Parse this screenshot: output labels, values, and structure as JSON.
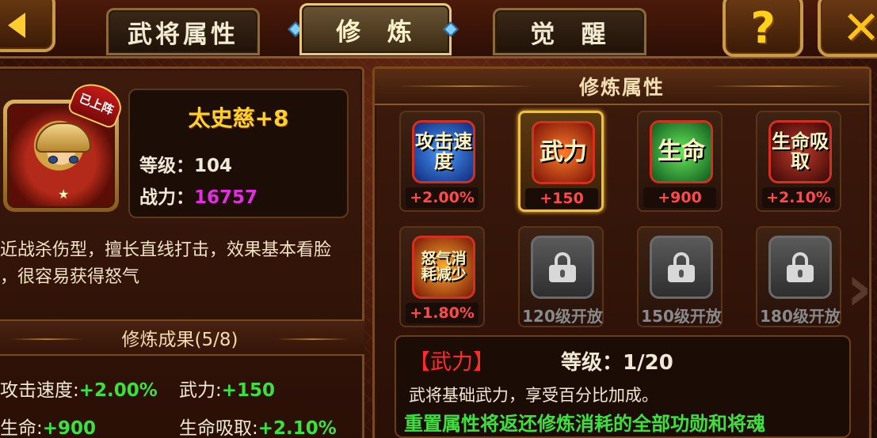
{
  "tabs": [
    {
      "label": "武将属性"
    },
    {
      "label": "修  炼"
    },
    {
      "label": "觉  醒"
    }
  ],
  "buttons": {
    "help": "?",
    "close": "✕",
    "back": "back-arrow-icon"
  },
  "hero": {
    "name": "太史慈+8",
    "badge": "已上阵",
    "level_label": "等级：",
    "level": "104",
    "power_label": "战力：",
    "power": "16757",
    "description_line1": "近战杀伤型，擅长直线打击，效果基本看脸",
    "description_line2": "，很容易获得怒气"
  },
  "training_result": {
    "title": "修炼成果(5/8)",
    "items": [
      {
        "label": "攻击速度:",
        "value": "+2.00%"
      },
      {
        "label": "武力:",
        "value": "+150"
      },
      {
        "label": "生命:",
        "value": "+900"
      },
      {
        "label": "生命吸取:",
        "value": "+2.10%"
      }
    ]
  },
  "training_attr": {
    "title": "修炼属性",
    "slots": [
      {
        "icon_text": "攻击速度",
        "value": "+2.00%",
        "icon": "attack-speed-icon"
      },
      {
        "icon_text": "武力",
        "value": "+150",
        "icon": "force-icon"
      },
      {
        "icon_text": "生命",
        "value": "+900",
        "icon": "life-icon"
      },
      {
        "icon_text": "生命吸取",
        "value": "+2.10%",
        "icon": "life-steal-icon"
      },
      {
        "icon_text": "怒气消耗减少",
        "value": "+1.80%",
        "icon": "rage-reduce-icon"
      },
      {
        "lock_text": "120级开放",
        "icon": "lock-icon"
      },
      {
        "lock_text": "150级开放",
        "icon": "lock-icon"
      },
      {
        "lock_text": "180级开放",
        "icon": "lock-icon"
      }
    ]
  },
  "detail": {
    "name": "【武力】",
    "level_label": "等级：",
    "level": "1/20",
    "description": "武将基础武力，享受百分比加成。",
    "note": "重置属性将返还修炼消耗的全部功勋和将魂"
  },
  "colors": {
    "accent_gold": "#ffcf2a",
    "positive": "#3ee03e",
    "power": "#e030e0",
    "negative_red": "#ff4a4a"
  }
}
